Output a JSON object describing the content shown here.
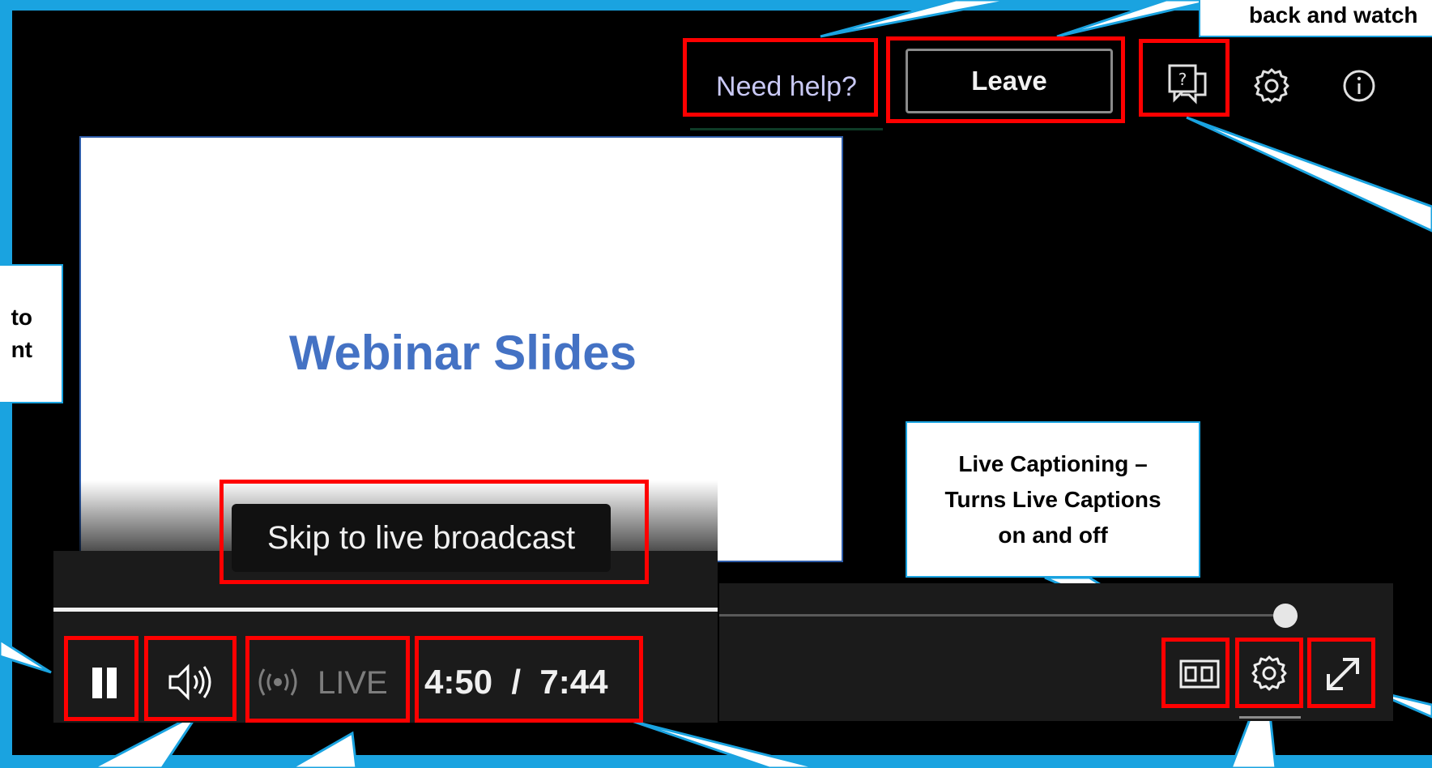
{
  "header": {
    "help_link": "Need help?",
    "leave_button": "Leave"
  },
  "slide": {
    "title": "Webinar Slides"
  },
  "tooltip": {
    "skip_live": "Skip to live broadcast"
  },
  "player": {
    "live_label": "LIVE",
    "time_display": "4:50  /  7:44"
  },
  "callouts": {
    "top_right_fragment": "back and watch",
    "left_fragment_line1": "to",
    "left_fragment_line2": "nt",
    "captions_line1": "Live Captioning –",
    "captions_line2": "Turns Live Captions",
    "captions_line3": "on and off"
  },
  "icons": {
    "qa": "q-and-a-icon",
    "settings_top": "gear-icon",
    "info": "info-icon",
    "pause": "pause-icon",
    "volume": "volume-icon",
    "live_broadcast": "broadcast-icon",
    "captions": "closed-captions-icon",
    "settings_player": "gear-icon",
    "fullscreen": "expand-icon"
  },
  "colors": {
    "frame": "#1aa3e0",
    "highlight": "#ff0000",
    "slide_title": "#4472c4"
  }
}
